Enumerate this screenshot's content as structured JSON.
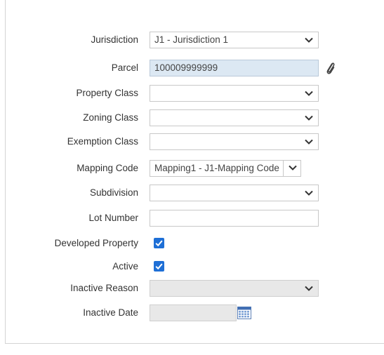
{
  "form": {
    "jurisdiction": {
      "label": "Jurisdiction",
      "value": "J1 - Jurisdiction 1"
    },
    "parcel": {
      "label": "Parcel",
      "value": "100009999999"
    },
    "property_class": {
      "label": "Property Class",
      "value": ""
    },
    "zoning_class": {
      "label": "Zoning Class",
      "value": ""
    },
    "exemption_class": {
      "label": "Exemption Class",
      "value": ""
    },
    "mapping_code": {
      "label": "Mapping Code",
      "value": "Mapping1 - J1-Mapping Code"
    },
    "subdivision": {
      "label": "Subdivision",
      "value": ""
    },
    "lot_number": {
      "label": "Lot Number",
      "value": ""
    },
    "developed_property": {
      "label": "Developed Property",
      "checked": true
    },
    "active": {
      "label": "Active",
      "checked": true
    },
    "inactive_reason": {
      "label": "Inactive Reason",
      "value": ""
    },
    "inactive_date": {
      "label": "Inactive Date",
      "value": ""
    }
  },
  "icons": {
    "attachment": "paperclip-icon",
    "calendar": "calendar-icon",
    "dropdown": "chevron-down-icon",
    "check": "checkmark-icon"
  },
  "colors": {
    "checkbox": "#1e6fd6",
    "parcel_background": "#dce8f3",
    "disabled_background": "#e8e8e8"
  }
}
